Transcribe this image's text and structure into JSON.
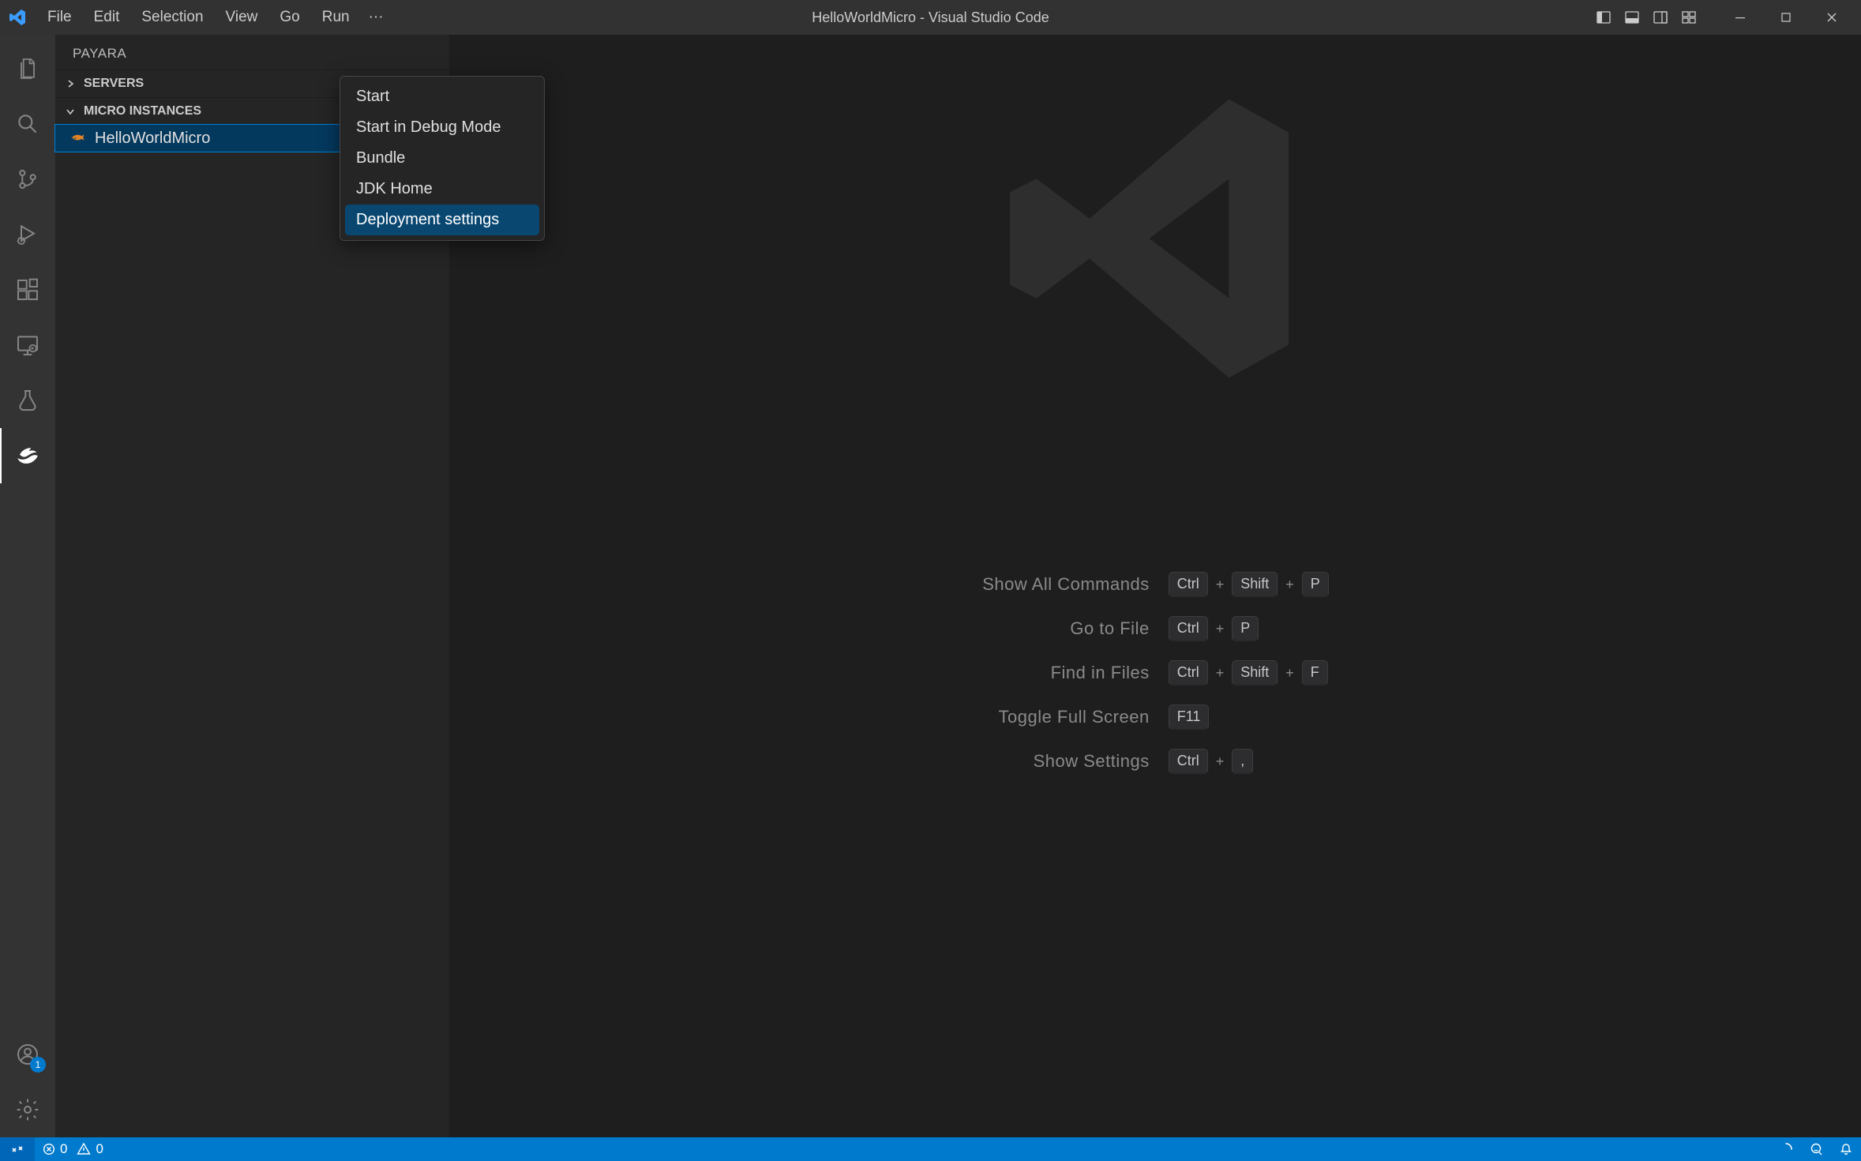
{
  "titlebar": {
    "title": "HelloWorldMicro - Visual Studio Code",
    "menu": [
      "File",
      "Edit",
      "Selection",
      "View",
      "Go",
      "Run"
    ]
  },
  "sidebar": {
    "title": "PAYARA",
    "sections": {
      "servers": {
        "label": "SERVERS",
        "expanded": false
      },
      "micro": {
        "label": "MICRO INSTANCES",
        "expanded": true
      }
    },
    "micro_instances": [
      {
        "label": "HelloWorldMicro",
        "selected": true
      }
    ]
  },
  "context_menu": {
    "items": [
      {
        "label": "Start",
        "hover": false
      },
      {
        "label": "Start in Debug Mode",
        "hover": false
      },
      {
        "label": "Bundle",
        "hover": false
      },
      {
        "label": "JDK Home",
        "hover": false
      },
      {
        "label": "Deployment settings",
        "hover": true
      }
    ]
  },
  "welcome_shortcuts": [
    {
      "label": "Show All Commands",
      "keys": [
        "Ctrl",
        "Shift",
        "P"
      ]
    },
    {
      "label": "Go to File",
      "keys": [
        "Ctrl",
        "P"
      ]
    },
    {
      "label": "Find in Files",
      "keys": [
        "Ctrl",
        "Shift",
        "F"
      ]
    },
    {
      "label": "Toggle Full Screen",
      "keys": [
        "F11"
      ]
    },
    {
      "label": "Show Settings",
      "keys": [
        "Ctrl",
        ","
      ]
    }
  ],
  "activitybar": {
    "accounts_badge": "1"
  },
  "statusbar": {
    "errors": "0",
    "warnings": "0"
  }
}
